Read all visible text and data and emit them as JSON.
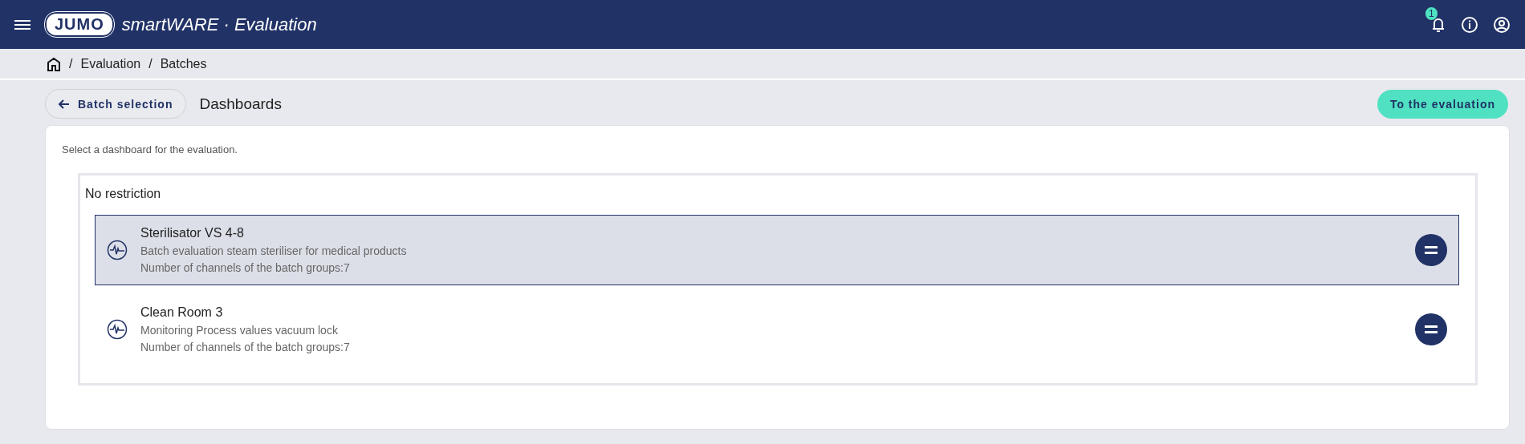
{
  "header": {
    "logo": "JUMO",
    "product": "smartWARE · Evaluation",
    "notifications": "1"
  },
  "breadcrumb": [
    {
      "separator": "/",
      "label": "Evaluation"
    },
    {
      "separator": "/",
      "label": "Batches"
    }
  ],
  "toolbar": {
    "back": "Batch selection",
    "title": "Dashboards",
    "action": "To the evaluation"
  },
  "intro": "Select a dashboard for the evaluation.",
  "group": {
    "title": "No restriction",
    "dashboards": [
      {
        "name": "Sterilisator VS 4-8",
        "description": "Batch evaluation steam steriliser for medical products",
        "channels": "Number of channels of the batch groups:7",
        "selected": true
      },
      {
        "name": "Clean Room 3",
        "description": "Monitoring Process values vacuum lock",
        "channels": "Number of channels of the batch groups:7",
        "selected": false
      }
    ]
  }
}
